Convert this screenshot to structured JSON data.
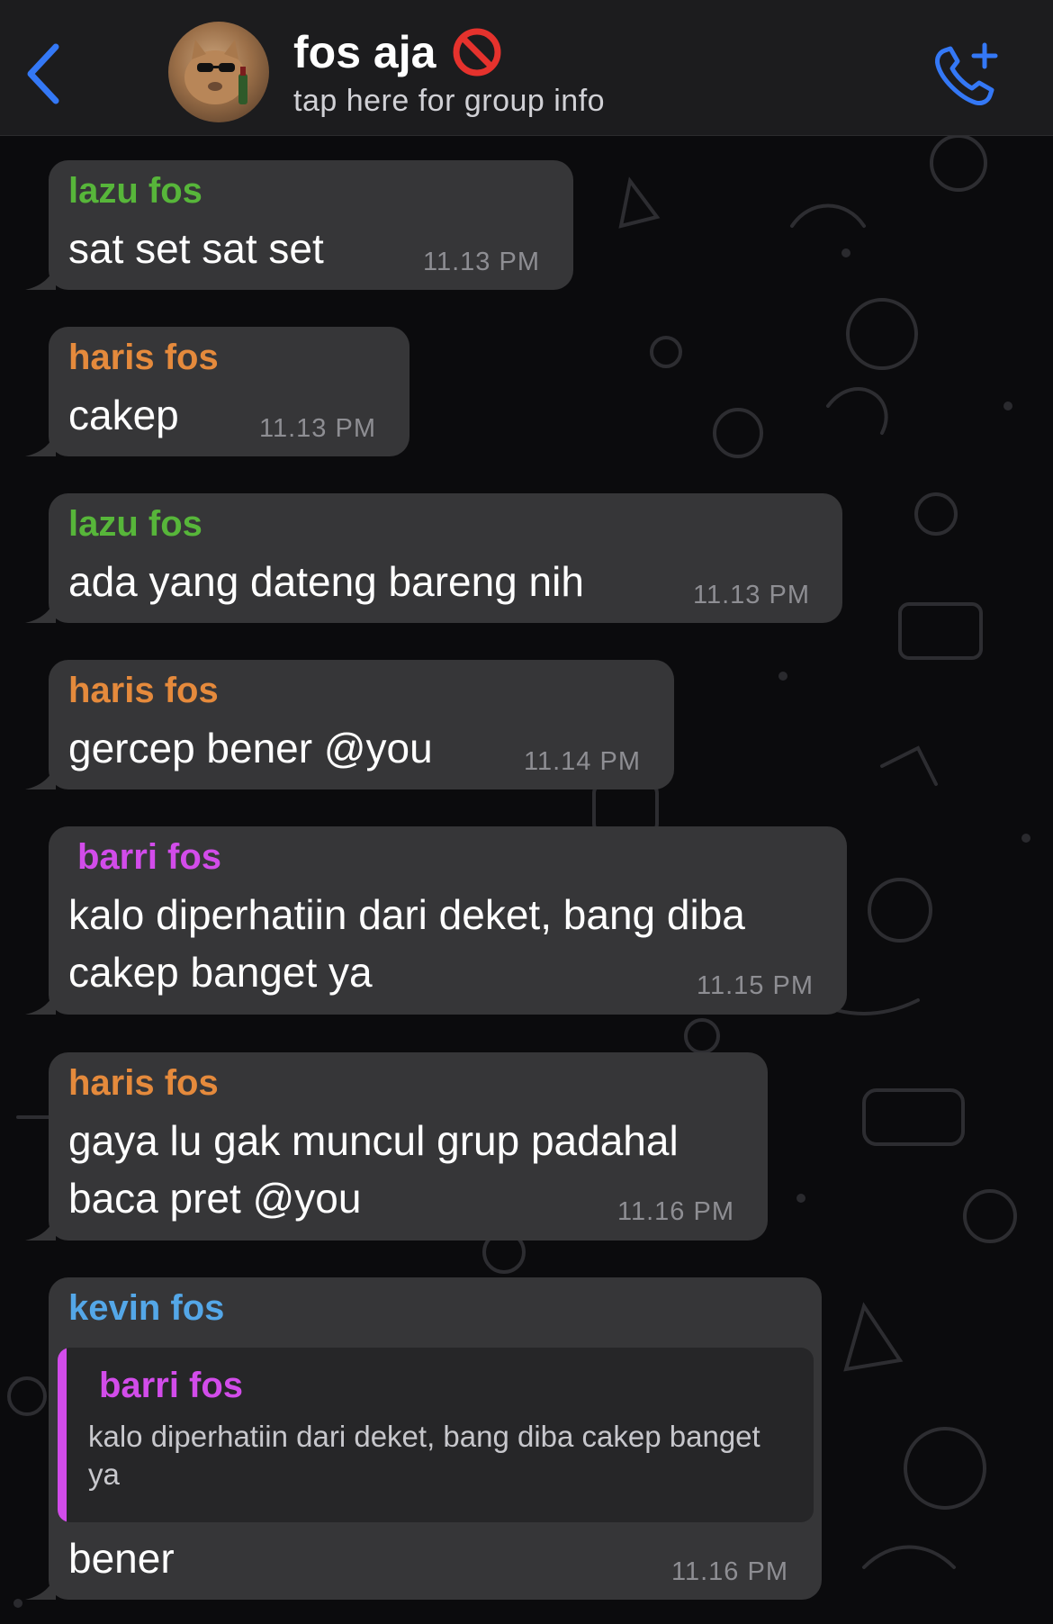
{
  "header": {
    "back_icon": "chevron-left-icon",
    "group_name": "fos aja",
    "status_emoji": "🚫",
    "subtitle": "tap here for group info",
    "call_icon": "add-call-icon"
  },
  "colors": {
    "accent_blue": "#3478f6",
    "bubble": "#363638",
    "lazu": "#57b63a",
    "haris": "#e58a3c",
    "barri": "#d24cea",
    "kevin": "#54a7e8"
  },
  "messages": [
    {
      "sender": "lazu fos",
      "text": "sat set sat set",
      "time": "11.13 PM"
    },
    {
      "sender": "haris fos",
      "text": "cakep",
      "time": "11.13 PM"
    },
    {
      "sender": "lazu fos",
      "text": "ada yang dateng bareng nih",
      "time": "11.13 PM"
    },
    {
      "sender": "haris fos",
      "text": "gercep bener @you",
      "time": "11.14 PM"
    },
    {
      "sender": "barri fos",
      "lines": [
        "kalo diperhatiin dari deket, bang diba",
        "cakep banget ya"
      ],
      "time": "11.15 PM"
    },
    {
      "sender": "haris fos",
      "lines": [
        "gaya lu gak muncul grup padahal",
        "baca pret @you"
      ],
      "time": "11.16 PM"
    },
    {
      "sender": "kevin fos",
      "quote": {
        "sender": "barri fos",
        "text": "kalo diperhatiin dari deket, bang diba cakep banget ya"
      },
      "text": "bener",
      "time": "11.16 PM"
    }
  ]
}
